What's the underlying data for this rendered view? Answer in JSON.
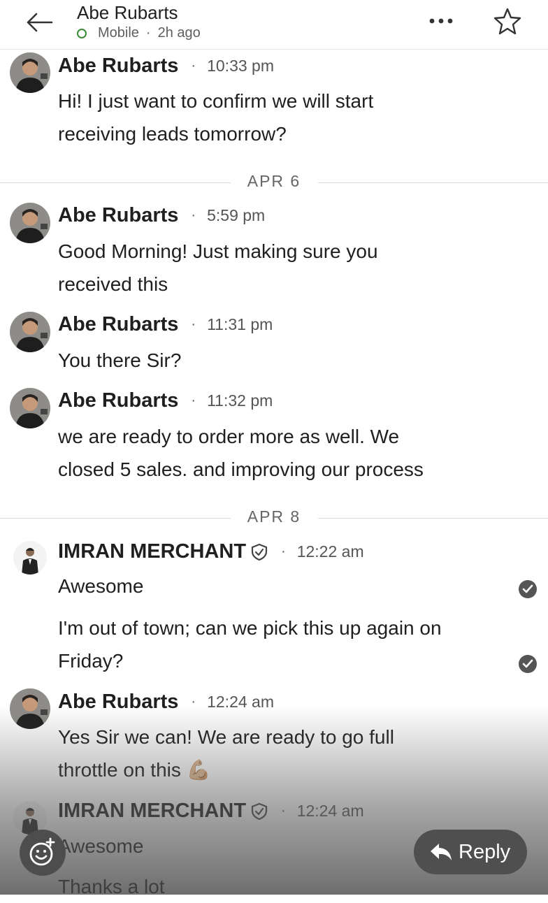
{
  "header": {
    "contact_name": "Abe Rubarts",
    "status": "Mobile",
    "last_seen": "2h ago"
  },
  "colors": {
    "status_online": "#3a8a3a",
    "text_primary": "#1f1f1f",
    "text_secondary": "#555555",
    "reply_button": "#4f4f4f"
  },
  "icons": {
    "back": "arrow-left-icon",
    "more": "ellipsis-icon",
    "star": "star-icon",
    "verified": "shield-check-icon",
    "read": "check-circle-icon",
    "emoji": "emoji-add-icon",
    "reply": "reply-arrow-icon"
  },
  "messages": [
    {
      "sender": "Abe Rubarts",
      "time": "10:33 pm",
      "lines": [
        "Hi! I just want to confirm we will start",
        "receiving leads tomorrow?"
      ]
    },
    {
      "date_separator": "APR 6"
    },
    {
      "sender": "Abe Rubarts",
      "time": "5:59 pm",
      "lines": [
        "Good Morning! Just making sure you",
        "received this"
      ]
    },
    {
      "sender": "Abe Rubarts",
      "time": "11:31 pm",
      "lines": [
        "You there Sir?"
      ]
    },
    {
      "sender": "Abe Rubarts",
      "time": "11:32 pm",
      "lines": [
        "we are ready to order more as well. We",
        "closed 5 sales. and improving our process"
      ]
    },
    {
      "date_separator": "APR 8"
    },
    {
      "sender": "IMRAN MERCHANT",
      "time": "12:22 am",
      "lines": [
        "Awesome",
        "I'm out of town; can we pick this up again on",
        "Friday?"
      ]
    },
    {
      "sender": "Abe Rubarts",
      "time": "12:24 am",
      "lines": [
        "Yes Sir we can! We are ready to go full",
        "throttle on this 💪🏼"
      ]
    },
    {
      "sender": "IMRAN MERCHANT",
      "time": "12:24 am",
      "lines": [
        "Awesome",
        "Thanks a lot"
      ]
    }
  ],
  "actions": {
    "reply_label": "Reply"
  }
}
